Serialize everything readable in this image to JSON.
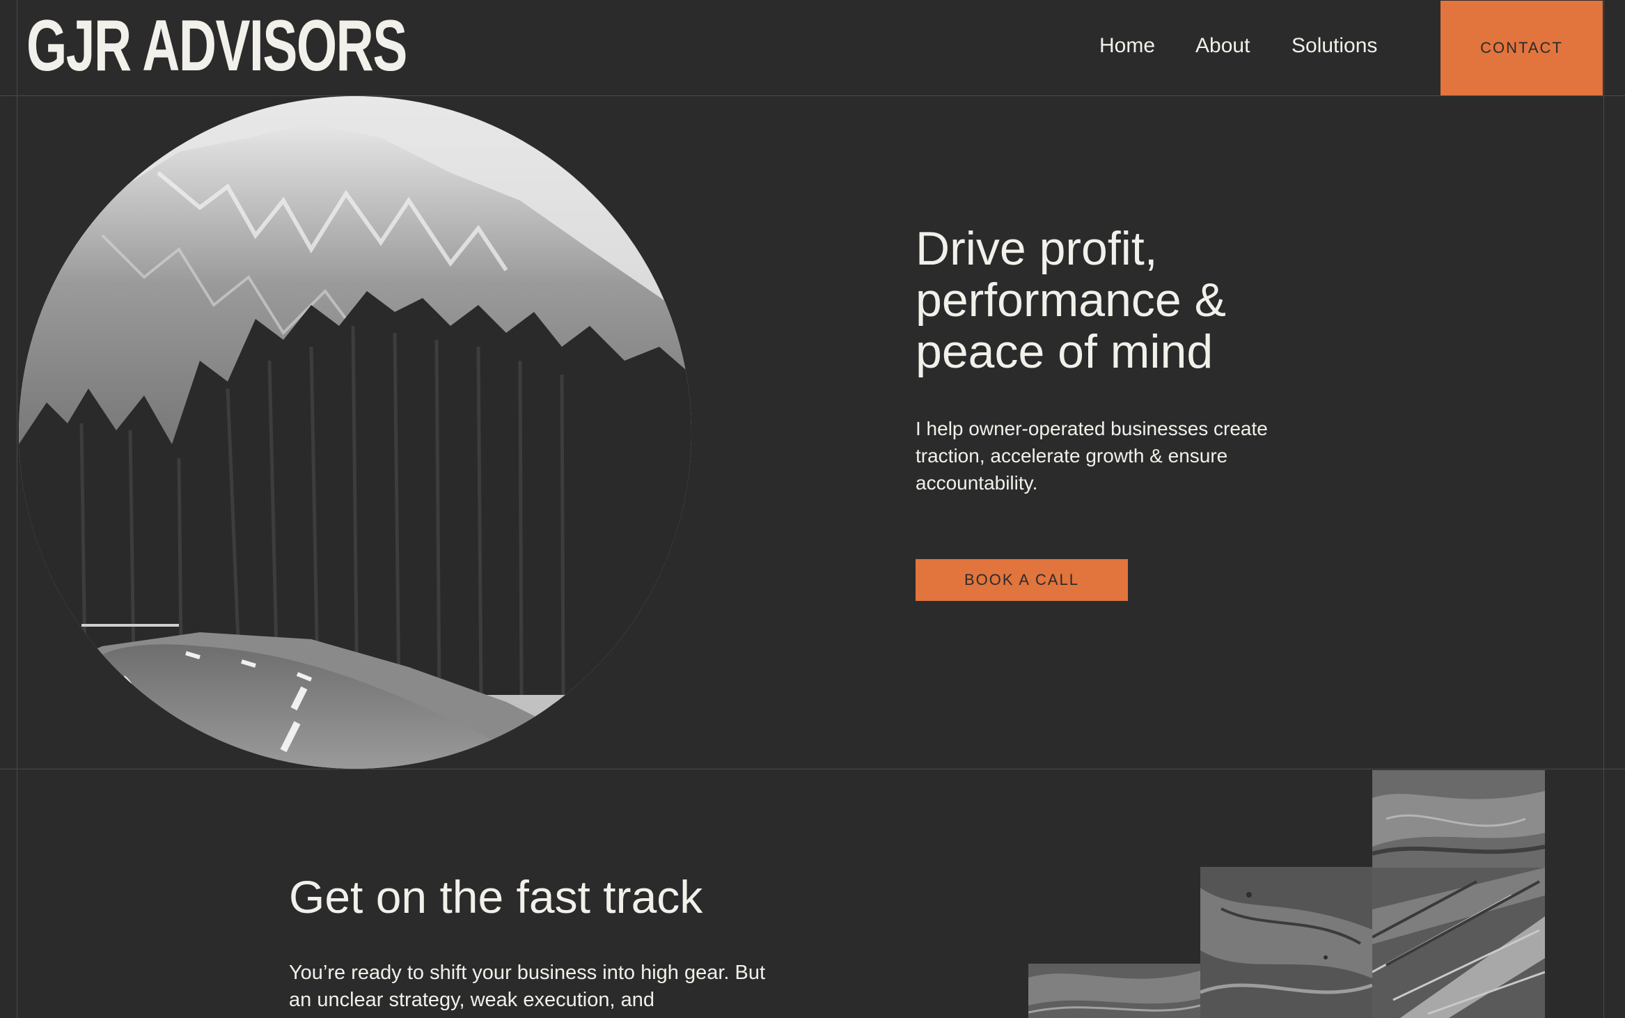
{
  "header": {
    "logo_text": "GJR ADVISORS",
    "nav": [
      "Home",
      "About",
      "Solutions"
    ],
    "contact_label": "CONTACT"
  },
  "hero": {
    "title_lines": [
      "Drive profit,",
      "performance &",
      "peace of mind"
    ],
    "subtitle_lines": [
      "I help owner-operated businesses create",
      "traction, accelerate growth & ensure",
      "accountability."
    ],
    "cta_label": "BOOK A CALL"
  },
  "section": {
    "title": "Get on the fast track",
    "body_lines": [
      "You’re ready to shift your business into high gear. But",
      "an unclear strategy, weak execution, and"
    ]
  },
  "colors": {
    "background": "#2b2b2b",
    "accent": "#e2743d",
    "text": "#f2f0ea"
  }
}
